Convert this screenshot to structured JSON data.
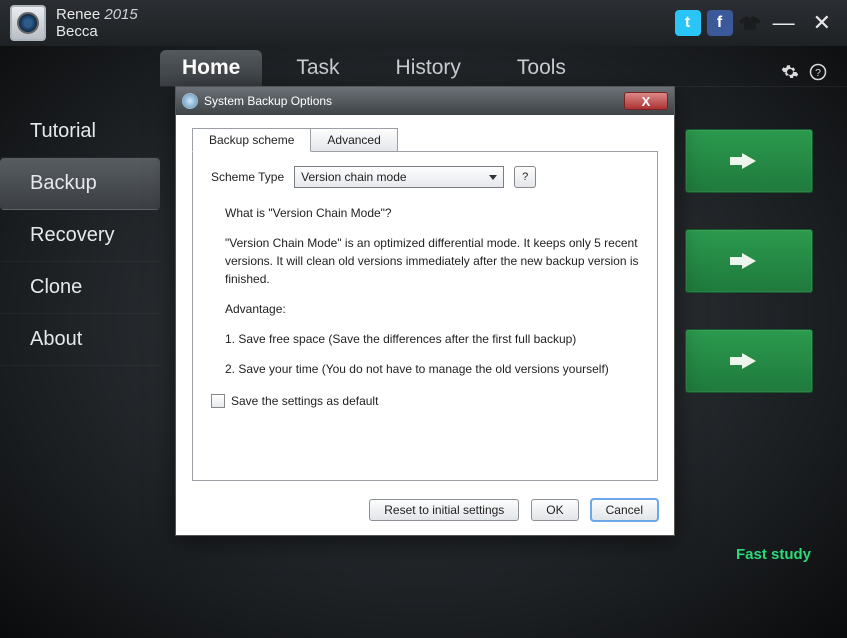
{
  "app": {
    "title1": "Renee",
    "year": "2015",
    "title2": "Becca"
  },
  "window": {
    "min": "—",
    "close": "✕"
  },
  "social": {
    "tw": "t",
    "fb": "f"
  },
  "tabs": {
    "home": "Home",
    "task": "Task",
    "history": "History",
    "tools": "Tools"
  },
  "sidebar": {
    "tutorial": "Tutorial",
    "backup": "Backup",
    "recovery": "Recovery",
    "clone": "Clone",
    "about": "About"
  },
  "link": {
    "faststudy": "Fast study"
  },
  "dialog": {
    "title": "System Backup Options",
    "tab_scheme": "Backup scheme",
    "tab_advanced": "Advanced",
    "scheme_type_label": "Scheme Type",
    "scheme_type_value": "Version chain mode",
    "help": "?",
    "q": "What is \"Version Chain Mode\"?",
    "desc": "\"Version Chain Mode\" is an optimized differential mode. It keeps only 5 recent versions. It will clean old versions immediately after the new backup version is finished.",
    "adv_head": "Advantage:",
    "adv1": "1. Save free space (Save the differences after the first full backup)",
    "adv2": "2. Save your time (You do not have to manage the old versions yourself)",
    "save_default": "Save the settings as default",
    "reset": "Reset to initial settings",
    "ok": "OK",
    "cancel": "Cancel",
    "close_x": "X"
  }
}
